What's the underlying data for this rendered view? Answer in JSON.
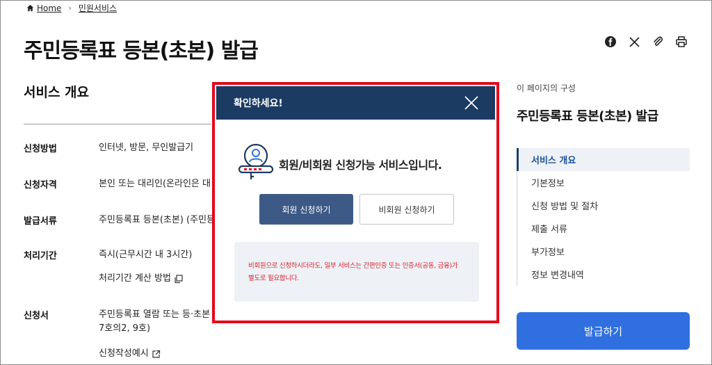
{
  "breadcrumb": {
    "home": "Home",
    "current": "민원서비스"
  },
  "page": {
    "title": "주민등록표 등본(초본) 발급"
  },
  "share": {
    "icons": [
      "facebook-icon",
      "x-icon",
      "clip-icon",
      "print-icon"
    ]
  },
  "overview": {
    "title": "서비스 개요",
    "rows": [
      {
        "label": "신청방법",
        "value": "인터넷, 방문, 무인발급기"
      },
      {
        "label": "신청자격",
        "value": "본인 또는 대리인(온라인은 대"
      },
      {
        "label": "발급서류",
        "value": "주민등록표 등본(초본) (주민등"
      },
      {
        "label": "처리기간",
        "value": "즉시(근무시간 내 3시간)",
        "link": "처리기간 계산 방법"
      },
      {
        "label": "신청서",
        "value": "주민등록표 열람 또는 등·초본",
        "value2": "7호의2, 9호)",
        "link": "신청작성예시"
      }
    ]
  },
  "toc": {
    "caption": "이 페이지의 구성",
    "title": "주민등록표 등본(초본) 발급",
    "items": [
      "서비스 개요",
      "기본정보",
      "신청 방법 및 절차",
      "제출 서류",
      "부가정보",
      "정보 변경내역"
    ]
  },
  "issue_button": "발급하기",
  "modal": {
    "title": "확인하세요!",
    "message": "회원/비회원 신청가능 서비스입니다.",
    "member_button": "회원 신청하기",
    "nonmember_button": "비회원 신청하기",
    "warning_line1": "비회원으로 신청하시더라도, 일부 서비스는 간편인증 또는 인증서(공동, 금융)가",
    "warning_line2": "별도로 필요합니다."
  },
  "colors": {
    "modal_header": "#1c3b63",
    "member_button": "#3d5a86",
    "issue_button": "#2f6fe0",
    "highlight": "#e3071c",
    "warning_text": "#d81f2c"
  }
}
